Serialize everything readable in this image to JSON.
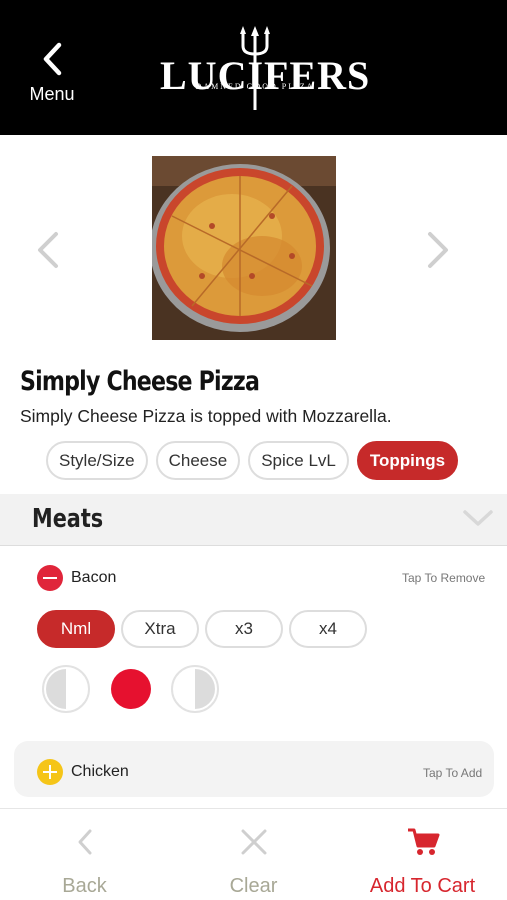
{
  "header": {
    "menu_label": "Menu",
    "logo_main": "LUCIFERS",
    "logo_sub": "DAMNED GOOD PIZZA"
  },
  "product": {
    "title": "Simply Cheese Pizza",
    "description": "Simply Cheese Pizza is topped with Mozzarella."
  },
  "tabs": [
    {
      "label": "Style/Size"
    },
    {
      "label": "Cheese"
    },
    {
      "label": "Spice LvL"
    },
    {
      "label": "Toppings"
    }
  ],
  "active_tab": "Toppings",
  "section": {
    "title": "Meats"
  },
  "toppings": [
    {
      "name": "Bacon",
      "hint": "Tap To Remove",
      "selected": true,
      "quantities": [
        "Nml",
        "Xtra",
        "x3",
        "x4"
      ],
      "selected_quantity": "Nml",
      "selected_portion": "whole"
    },
    {
      "name": "Chicken",
      "hint": "Tap To Add",
      "selected": false
    }
  ],
  "bottom_bar": {
    "back_label": "Back",
    "clear_label": "Clear",
    "cart_label": "Add To Cart"
  },
  "colors": {
    "accent": "#c62a2a",
    "remove": "#e0253a",
    "add": "#f5c518",
    "cart": "#d7262e",
    "header_bg": "#000000"
  },
  "icons": {
    "menu": "chevron-left-icon",
    "carousel_prev": "chevron-left-icon",
    "carousel_next": "chevron-right-icon",
    "section_toggle": "chevron-down-icon",
    "back": "chevron-left-icon",
    "clear": "close-icon",
    "cart": "cart-icon"
  }
}
